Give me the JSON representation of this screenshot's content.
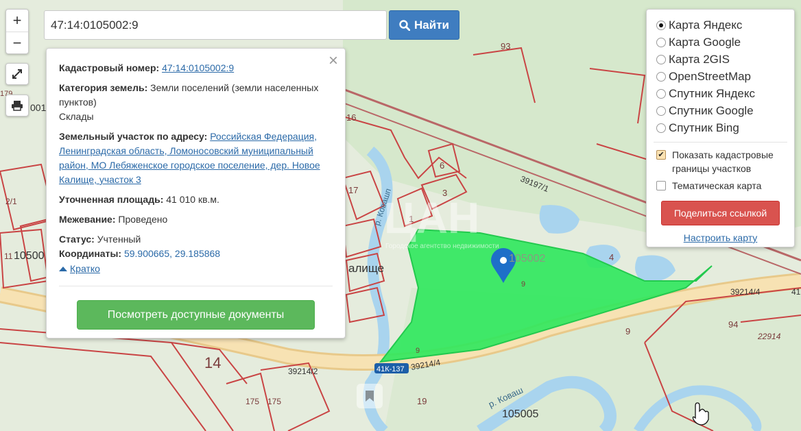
{
  "search": {
    "value": "47:14:0105002:9",
    "button_label": "Найти"
  },
  "zoom": {
    "in_label": "+",
    "out_label": "−"
  },
  "info_panel": {
    "close_label": "×",
    "cadastral_label": "Кадастровый номер:",
    "cadastral_value": "47:14:0105002:9",
    "category_label": "Категория земель:",
    "category_value": "Земли поселений (земли населенных пунктов)",
    "category_use": "Склады",
    "address_label": "Земельный участок по адресу:",
    "address_value": "Российская Федерация, Ленинградская область, Ломоносовский муниципальный район, МО Лебяженское городское поселение, дер. Новое Калище, участок 3",
    "area_label": "Уточненная площадь:",
    "area_value": "41 010 кв.м.",
    "survey_label": "Межевание:",
    "survey_value": "Проведено",
    "status_label": "Статус:",
    "status_value": "Учтенный",
    "coords_label": "Координаты:",
    "coords_value": "59.900665, 29.185868",
    "brief_label": "Кратко",
    "docs_button": "Посмотреть доступные документы"
  },
  "layers_panel": {
    "options": [
      {
        "label": "Карта Яндекс",
        "selected": true
      },
      {
        "label": "Карта Google",
        "selected": false
      },
      {
        "label": "Карта 2GIS",
        "selected": false
      },
      {
        "label": "OpenStreetMap",
        "selected": false
      },
      {
        "label": "Спутник Яндекс",
        "selected": false
      },
      {
        "label": "Спутник Google",
        "selected": false
      },
      {
        "label": "Спутник Bing",
        "selected": false
      }
    ],
    "show_boundaries_label": "Показать кадастровые границы участков",
    "show_boundaries_checked": true,
    "thematic_label": "Тематическая карта",
    "thematic_checked": false,
    "share_button": "Поделиться ссылкой",
    "setup_link": "Настроить карту"
  },
  "map": {
    "labels": {
      "n93": "93",
      "n16": "16",
      "n6": "6",
      "n3": "3",
      "n1": "1",
      "n17": "17",
      "n4": "4",
      "n9a": "9",
      "n9b": "9",
      "n9c": "9",
      "n94": "94",
      "n22914": "22914",
      "n105002": "105002",
      "n105005": "105005",
      "n105_left": "10500",
      "n14": "14",
      "n175a": "175",
      "n175b": "175",
      "n19": "19",
      "n11": "11",
      "n2_1": "2/1",
      "n001": "001",
      "n179": "179",
      "road_39197_1": "39197/1",
      "road_39214_4a": "39214/4",
      "road_39214_4b": "39214/4",
      "road_39214_2": "39214/2",
      "road_41k137": "41К-137",
      "road_41": "41",
      "river_kovash_a": "р. Ковашп",
      "river_kovash_b": "р. Коваш",
      "village": "алище",
      "watermark": "ЦАН",
      "watermark_sub": "Городское агентство недвижимости"
    },
    "colors": {
      "parcel_highlight": "#2ee85c",
      "parcel_border": "#c62828",
      "road": "#f3d9a0",
      "water": "#a9d4ee",
      "forest": "#d8ead0",
      "marker": "#1e6fc8"
    }
  }
}
